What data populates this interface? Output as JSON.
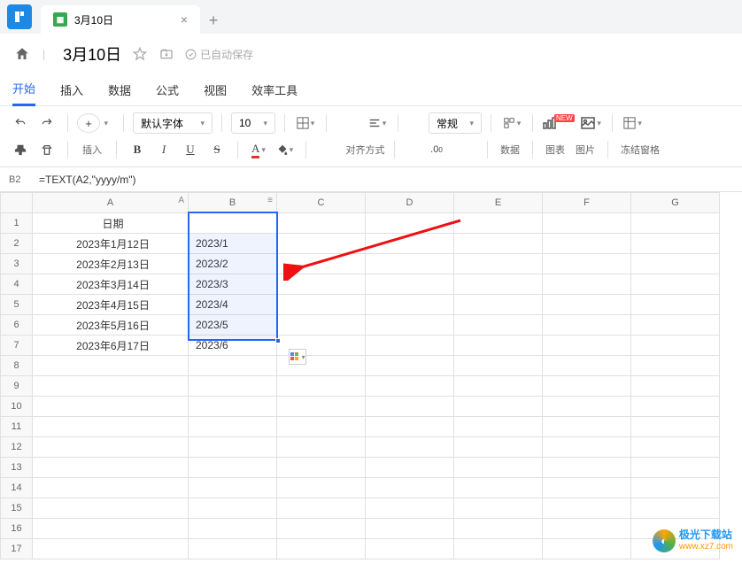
{
  "tab": {
    "title": "3月10日"
  },
  "doc": {
    "title": "3月10日",
    "autosave": "已自动保存"
  },
  "menu": {
    "items": [
      "开始",
      "插入",
      "数据",
      "公式",
      "视图",
      "效率工具"
    ],
    "activeIndex": 0
  },
  "toolbar": {
    "font": "默认字体",
    "fontSize": "10",
    "insert": "插入",
    "format": "常规",
    "decimal": ".0",
    "align": "对齐方式",
    "data": "数据",
    "chart": "图表",
    "image": "图片",
    "freeze": "冻结窗格",
    "new": "NEW",
    "decimal0": ".0"
  },
  "formula": {
    "cellRef": "B2",
    "value": "=TEXT(A2,\"yyyy/m\")"
  },
  "grid": {
    "cols": [
      "A",
      "B",
      "C",
      "D",
      "E",
      "F",
      "G"
    ],
    "header": {
      "a1": "日期"
    },
    "rows": [
      {
        "a": "2023年1月12日",
        "b": "2023/1"
      },
      {
        "a": "2023年2月13日",
        "b": "2023/2"
      },
      {
        "a": "2023年3月14日",
        "b": "2023/3"
      },
      {
        "a": "2023年4月15日",
        "b": "2023/4"
      },
      {
        "a": "2023年5月16日",
        "b": "2023/5"
      },
      {
        "a": "2023年6月17日",
        "b": "2023/6"
      }
    ],
    "rowCount": 17
  },
  "watermark": {
    "cn": "极光下载站",
    "url": "www.xz7.com"
  }
}
